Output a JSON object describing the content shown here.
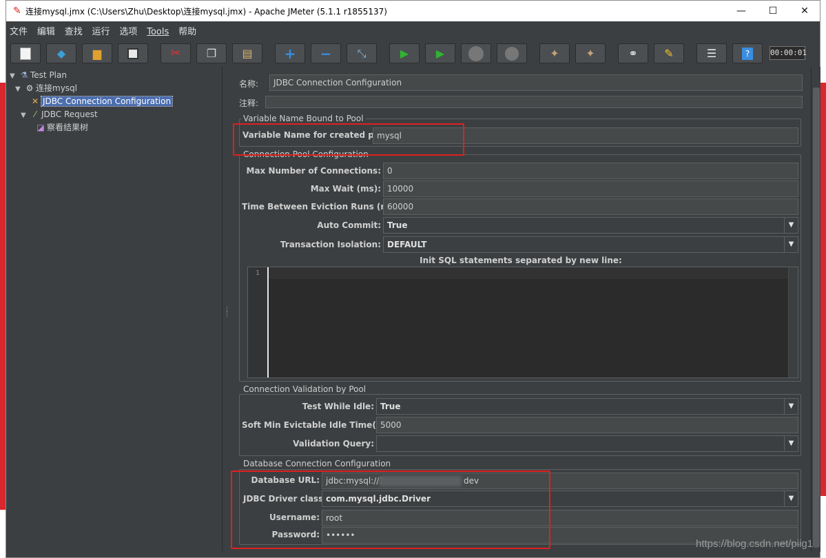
{
  "window": {
    "title": "连接mysql.jmx (C:\\Users\\Zhu\\Desktop\\连接mysql.jmx) - Apache JMeter (5.1.1 r1855137)",
    "minimize_glyph": "—",
    "maximize_glyph": "☐",
    "close_glyph": "✕"
  },
  "menu": [
    "文件",
    "编辑",
    "查找",
    "运行",
    "选项",
    "Tools",
    "帮助"
  ],
  "toolbar": {
    "timer": "00:00:01",
    "icons": [
      "new-icon",
      "templates-icon",
      "open-icon",
      "save-icon",
      "cut-icon",
      "copy-icon",
      "paste-icon",
      "expand-icon",
      "collapse-icon",
      "toggle-icon",
      "start-icon",
      "start-no-pauses-icon",
      "stop-icon",
      "shutdown-icon",
      "clear-icon",
      "clear-all-icon",
      "search-icon",
      "reset-search-icon",
      "function-helper-icon",
      "help-icon"
    ]
  },
  "tree": {
    "items": [
      {
        "label": "Test Plan",
        "icon": "flask-icon"
      },
      {
        "label": "连接mysql",
        "icon": "gear-icon"
      },
      {
        "label": "JDBC Connection Configuration",
        "icon": "wrench-icon"
      },
      {
        "label": "JDBC Request",
        "icon": "pipette-icon"
      },
      {
        "label": "察看结果树",
        "icon": "chart-icon"
      }
    ]
  },
  "form": {
    "name_label": "名称:",
    "name_value": "JDBC Connection Configuration",
    "comment_label": "注释:",
    "comment_value": "",
    "bound": {
      "title": "Variable Name Bound to Pool",
      "var_label": "Variable Name for created pool:",
      "var_value": "mysql"
    },
    "pool": {
      "title": "Connection Pool Configuration",
      "max_conn_label": "Max Number of Connections:",
      "max_conn_value": "0",
      "max_wait_label": "Max Wait (ms):",
      "max_wait_value": "10000",
      "eviction_label": "Time Between Eviction Runs (ms):",
      "eviction_value": "60000",
      "auto_commit_label": "Auto Commit:",
      "auto_commit_value": "True",
      "isolation_label": "Transaction Isolation:",
      "isolation_value": "DEFAULT",
      "init_sql_label": "Init SQL statements separated by new line:",
      "line_number": "1"
    },
    "validation": {
      "title": "Connection Validation by Pool",
      "test_idle_label": "Test While Idle:",
      "test_idle_value": "True",
      "soft_min_label": "Soft Min Evictable Idle Time(ms):",
      "soft_min_value": "5000",
      "query_label": "Validation Query:",
      "query_value": ""
    },
    "database": {
      "title": "Database Connection Configuration",
      "url_label": "Database URL:",
      "url_prefix": "jdbc:mysql://3",
      "url_suffix": "dev",
      "driver_label": "JDBC Driver class:",
      "driver_value": "com.mysql.jdbc.Driver",
      "user_label": "Username:",
      "user_value": "root",
      "password_label": "Password:",
      "password_value": "••••••"
    }
  },
  "watermark": "https://blog.csdn.net/piig1",
  "annotation_color": "#e02020",
  "dropdown_glyph": "▼"
}
